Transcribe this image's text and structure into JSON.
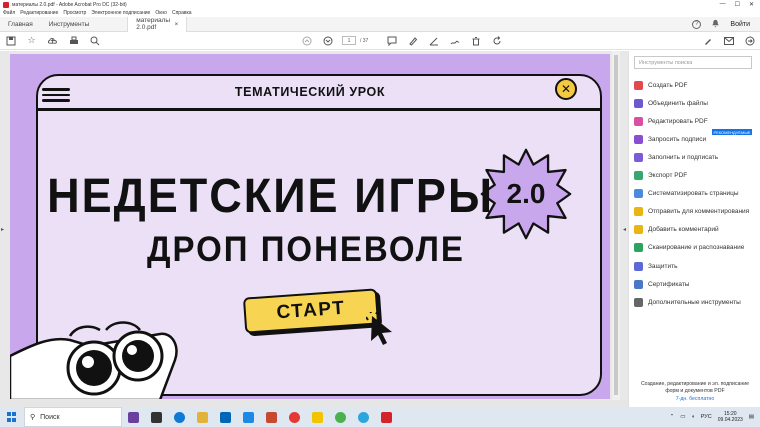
{
  "window": {
    "title": "материалы 2.0.pdf - Adobe Acrobat Pro DC (32-bit)",
    "controls": [
      "—",
      "☐",
      "✕"
    ]
  },
  "menu": [
    "Файл",
    "Редактирование",
    "Просмотр",
    "Электронное подписание",
    "Окно",
    "Справка"
  ],
  "tabs": {
    "home": "Главная",
    "tools": "Инструменты",
    "doc": "материалы 2.0.pdf",
    "doc_close": "×",
    "help": "?",
    "signin": "Войти"
  },
  "toolbar": {
    "page_current": "1",
    "page_total": "/ 37"
  },
  "slide": {
    "label": "ТЕМАТИЧЕСКИЙ УРОК",
    "title_line1": "НЕДЕТСКИЕ ИГРЫ",
    "badge": "2.0",
    "title_line2": "ДРОП ПОНЕВОЛЕ",
    "start": "СТАРТ",
    "close_glyph": "✕"
  },
  "tools_panel": {
    "search_placeholder": "Инструменты поиска",
    "recommended": "РЕКОМЕНДУЕМЫЕ",
    "items": [
      {
        "label": "Создать PDF",
        "icon": "create-pdf-icon",
        "color": "#e34850"
      },
      {
        "label": "Объединить файлы",
        "icon": "combine-files-icon",
        "color": "#6a5acd"
      },
      {
        "label": "Редактировать PDF",
        "icon": "edit-pdf-icon",
        "color": "#d94fa1"
      },
      {
        "label": "Запросить подписи",
        "icon": "request-signatures-icon",
        "color": "#8a4fd1"
      },
      {
        "label": "Заполнить и подписать",
        "icon": "fill-sign-icon",
        "color": "#7b5cd6"
      },
      {
        "label": "Экспорт PDF",
        "icon": "export-pdf-icon",
        "color": "#3aa66f"
      },
      {
        "label": "Систематизировать страницы",
        "icon": "organize-pages-icon",
        "color": "#4a8be0"
      },
      {
        "label": "Отправить для комментирования",
        "icon": "send-comments-icon",
        "color": "#e8b512"
      },
      {
        "label": "Добавить комментарий",
        "icon": "comment-icon",
        "color": "#e8b512"
      },
      {
        "label": "Сканирование и распознавание",
        "icon": "scan-icon",
        "color": "#2ea25f"
      },
      {
        "label": "Защитить",
        "icon": "protect-icon",
        "color": "#5b6ad6"
      },
      {
        "label": "Сертификаты",
        "icon": "certificates-icon",
        "color": "#4a78c8"
      },
      {
        "label": "Дополнительные инструменты",
        "icon": "more-tools-icon",
        "color": "#666666"
      }
    ],
    "promo": "Создание, редактирование и эл. подписание форм и документов PDF",
    "promo_link": "7-дн. бесплатно"
  },
  "taskbar": {
    "search": "Поиск",
    "lang": "РУС",
    "time": "15:20",
    "date": "09.04.2023"
  },
  "colors": {
    "slide_bg": "#c9a7ec",
    "card_bg": "#ebe0f6",
    "accent_yellow": "#f7d553",
    "acrobat_red": "#d4232b"
  }
}
